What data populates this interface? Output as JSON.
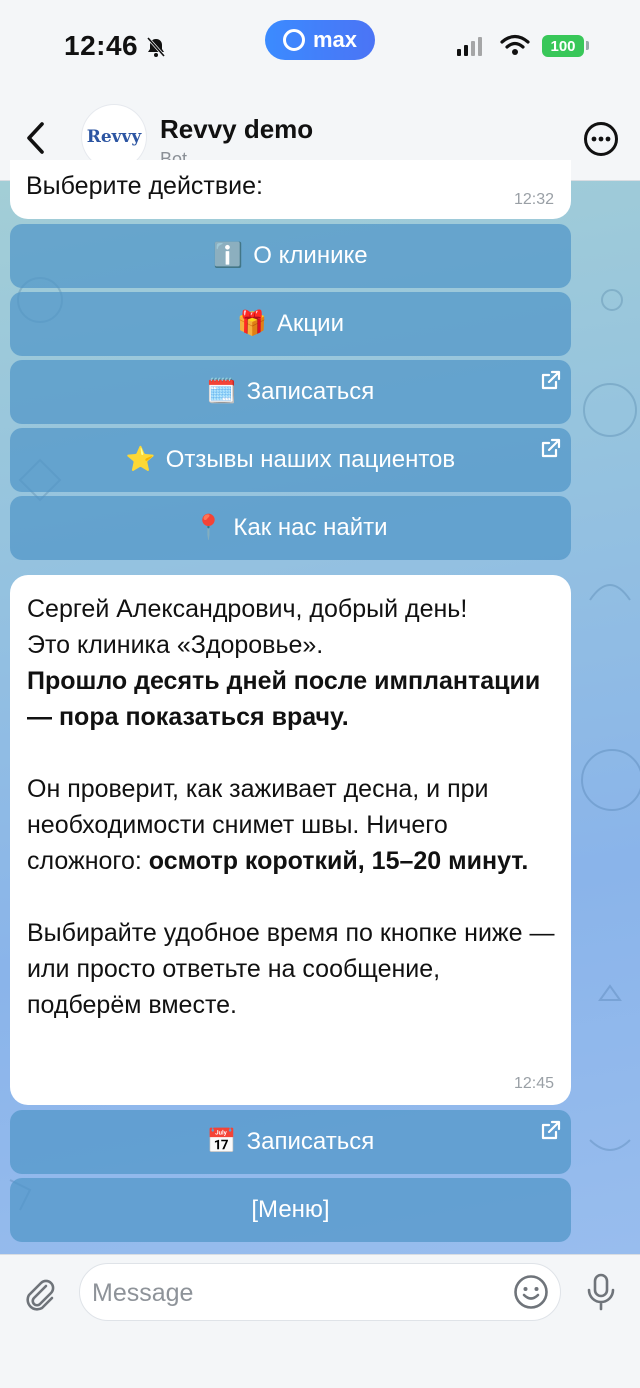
{
  "status_bar": {
    "time": "12:46",
    "center_app": "max",
    "battery": "100"
  },
  "header": {
    "avatar_text": "Revvy",
    "title": "Revvy demo",
    "subtitle": "Bot",
    "icons": {
      "back": "chevron-left-icon",
      "more": "more-circle-icon"
    }
  },
  "messages": [
    {
      "text": "Выберите действие:",
      "time": "12:32"
    }
  ],
  "keyboard_1": [
    {
      "emoji": "ℹ️",
      "label": "О клинике",
      "external": false
    },
    {
      "emoji": "🎁",
      "label": "Акции",
      "external": false
    },
    {
      "emoji": "🗓️",
      "label": "Записаться",
      "external": true
    },
    {
      "emoji": "⭐",
      "label": "Отзывы наших пациентов",
      "external": true
    },
    {
      "emoji": "📍",
      "label": "Как нас найти",
      "external": false
    }
  ],
  "message_2": {
    "line1": "Сергей Александрович, добрый день!",
    "line2": "Это клиника «Здоровье».",
    "bold1": "Прошло десять дней после имплантации — пора показаться врачу.",
    "p2_plain": "Он проверит, как заживает десна, и при необходимости снимет швы. Ничего сложного: ",
    "p2_bold": "осмотр короткий, 15–20 минут.",
    "p3": "Выбирайте удобное время по кнопке ниже — или просто ответьте на сообщение, подберём вместе.",
    "time": "12:45"
  },
  "keyboard_2": [
    {
      "emoji": "📅",
      "label": "Записаться",
      "external": true
    },
    {
      "emoji": "",
      "label": "[Меню]",
      "external": false
    }
  ],
  "composer": {
    "placeholder": "Message",
    "icons": {
      "attach": "paperclip-icon",
      "sticker": "smiley-icon",
      "voice": "microphone-icon"
    }
  }
}
